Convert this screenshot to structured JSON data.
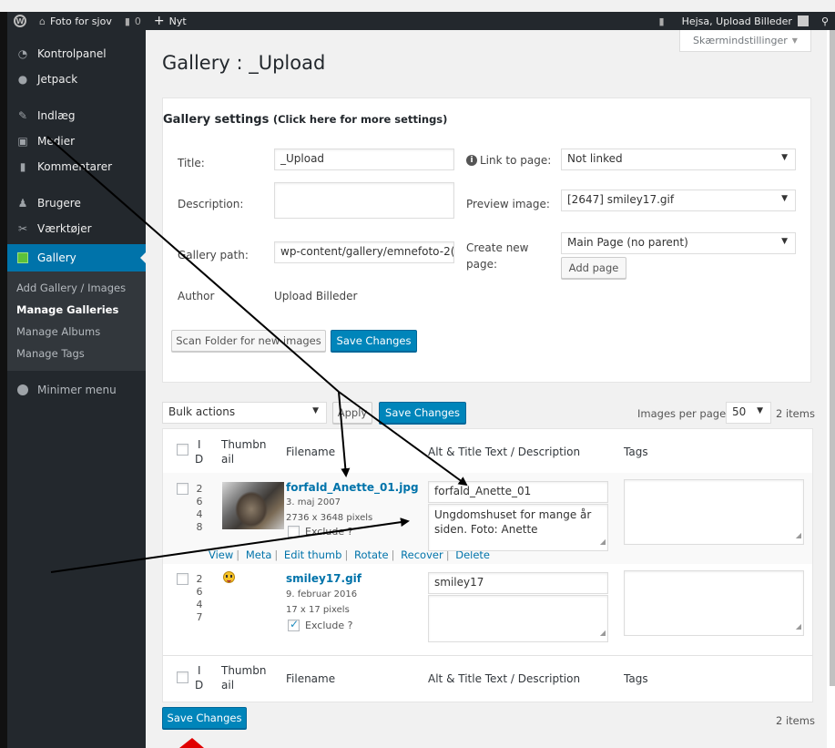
{
  "adminbar": {
    "site_name": "Foto for sjov",
    "comments_count": "0",
    "new_label": "Nyt",
    "greeting": "Hejsa, Upload Billeder"
  },
  "menu": {
    "items": [
      {
        "label": "Kontrolpanel",
        "icon": "dashboard-icon"
      },
      {
        "label": "Jetpack",
        "icon": "jetpack-icon"
      },
      {
        "label": "Indlæg",
        "icon": "pin-icon"
      },
      {
        "label": "Medier",
        "icon": "media-icon"
      },
      {
        "label": "Kommentarer",
        "icon": "comment-icon"
      },
      {
        "label": "Brugere",
        "icon": "users-icon"
      },
      {
        "label": "Værktøjer",
        "icon": "tools-icon"
      }
    ],
    "gallery_label": "Gallery",
    "submenu": [
      "Add Gallery / Images",
      "Manage Galleries",
      "Manage Albums",
      "Manage Tags"
    ],
    "collapse_label": "Minimer menu"
  },
  "screen_options": "Skærmindstillinger",
  "page_title": "Gallery : _Upload",
  "settings": {
    "heading": "Gallery settings",
    "heading_small": "(Click here for more settings)",
    "title_label": "Title:",
    "title_value": "_Upload",
    "description_label": "Description:",
    "description_value": "",
    "path_label": "Gallery path:",
    "path_value": "wp-content/gallery/emnefoto-2(",
    "author_label": "Author",
    "author_value": "Upload Billeder",
    "link_label": "Link to page:",
    "link_value": "Not linked",
    "preview_label": "Preview image:",
    "preview_value": "[2647] smiley17.gif",
    "create_label_1": "Create new",
    "create_label_2": "page:",
    "create_value": "Main Page (no parent)",
    "add_page": "Add page",
    "scan_button": "Scan Folder for new images",
    "save_button": "Save Changes"
  },
  "toolbar": {
    "bulk_actions": "Bulk actions",
    "apply": "Apply",
    "save": "Save Changes",
    "per_page_label": "Images per page:",
    "per_page_value": "50",
    "items_count": "2 items"
  },
  "table": {
    "col_id_1": "I",
    "col_id_2": "D",
    "col_thumb_1": "Thumbn",
    "col_thumb_2": "ail",
    "col_filename": "Filename",
    "col_alt": "Alt & Title Text / Description",
    "col_tags": "Tags",
    "rows": [
      {
        "id_digits": [
          "2",
          "6",
          "4",
          "8"
        ],
        "filename": "forfald_Anette_01.jpg",
        "date": "3. maj 2007",
        "size": "2736 x 3648 pixels",
        "exclude": "Exclude ?",
        "excluded": false,
        "alt": "forfald_Anette_01",
        "description": "Ungdomshuset for mange år siden. Foto: Anette",
        "tags": "",
        "actions": [
          "View",
          "Meta",
          "Edit thumb",
          "Rotate",
          "Recover",
          "Delete"
        ]
      },
      {
        "id_digits": [
          "2",
          "6",
          "4",
          "7"
        ],
        "filename": "smiley17.gif",
        "date": "9. februar 2016",
        "size": "17 x 17 pixels",
        "exclude": "Exclude ?",
        "excluded": true,
        "alt": "smiley17",
        "description": "",
        "tags": ""
      }
    ]
  },
  "footer": {
    "save": "Save Changes",
    "items_count": "2 items"
  },
  "colors": {
    "primary": "#0085ba",
    "menu_bg": "#23282d",
    "arrow_black": "#000000",
    "arrow_red": "#e00000"
  }
}
